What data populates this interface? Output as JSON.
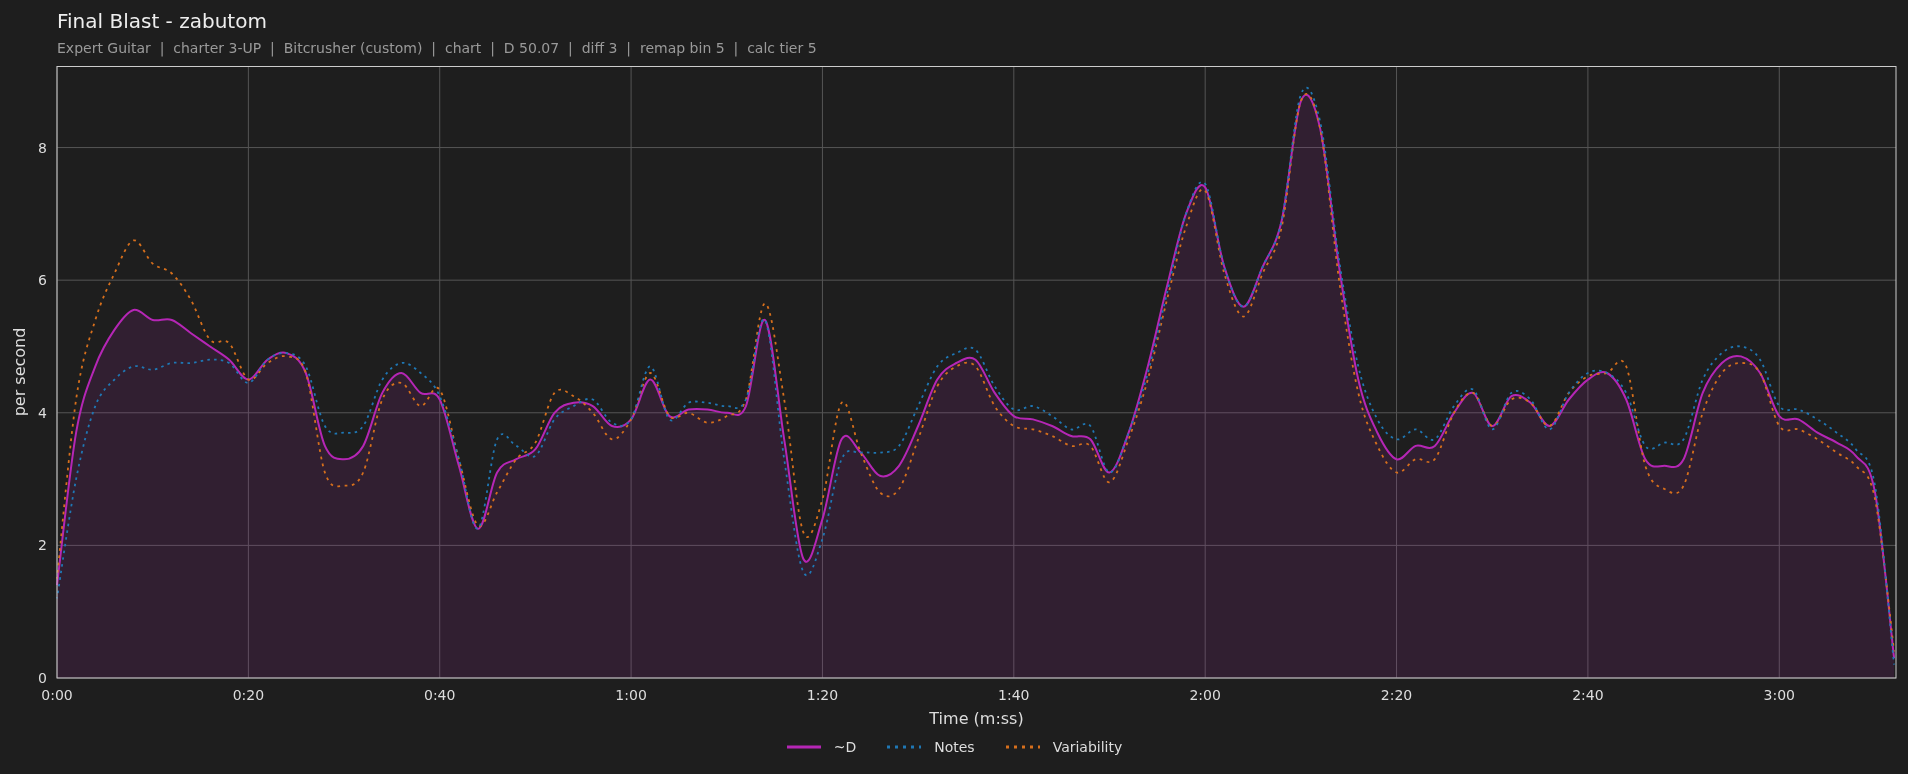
{
  "title": "Final Blast - zabutom",
  "subtitle": "Expert Guitar  |  charter 3-UP  |  Bitcrusher (custom)  |  chart  |  D 50.07  |  diff 3  |  remap bin 5  |  calc tier 5",
  "chart": {
    "chart_data": {
      "type": "line",
      "grid": true,
      "xlabel": "Time (m:ss)",
      "ylabel": "per second",
      "x": [
        0,
        2,
        4,
        6,
        8,
        10,
        12,
        14,
        16,
        18,
        20,
        22,
        24,
        26,
        28,
        30,
        32,
        34,
        36,
        38,
        40,
        42,
        44,
        46,
        48,
        50,
        52,
        54,
        56,
        58,
        60,
        62,
        64,
        66,
        68,
        70,
        72,
        74,
        76,
        78,
        80,
        82,
        84,
        86,
        88,
        90,
        92,
        94,
        96,
        98,
        100,
        102,
        104,
        106,
        108,
        110,
        112,
        114,
        116,
        118,
        120,
        122,
        124,
        126,
        128,
        130,
        132,
        134,
        136,
        138,
        140,
        142,
        144,
        146,
        148,
        150,
        152,
        154,
        156,
        158,
        160,
        162,
        164,
        166,
        168,
        170,
        172,
        174,
        176,
        178,
        180,
        182,
        184,
        186,
        188,
        190,
        192
      ],
      "series": [
        {
          "name": "~D",
          "color": "#b526b5",
          "line_style": "solid",
          "type": "area",
          "values": [
            1.4,
            3.7,
            4.7,
            5.25,
            5.55,
            5.4,
            5.4,
            5.2,
            5.0,
            4.8,
            4.5,
            4.8,
            4.9,
            4.6,
            3.5,
            3.3,
            3.5,
            4.3,
            4.6,
            4.3,
            4.2,
            3.2,
            2.25,
            3.1,
            3.3,
            3.45,
            4.0,
            4.15,
            4.1,
            3.8,
            3.9,
            4.5,
            3.95,
            4.05,
            4.05,
            4.0,
            4.1,
            5.4,
            3.6,
            1.8,
            2.4,
            3.6,
            3.4,
            3.05,
            3.2,
            3.8,
            4.5,
            4.75,
            4.8,
            4.3,
            3.95,
            3.9,
            3.8,
            3.65,
            3.6,
            3.1,
            3.7,
            4.7,
            5.9,
            7.0,
            7.4,
            6.2,
            5.6,
            6.2,
            6.9,
            8.7,
            8.3,
            6.2,
            4.5,
            3.7,
            3.3,
            3.5,
            3.5,
            4.0,
            4.3,
            3.8,
            4.25,
            4.15,
            3.8,
            4.2,
            4.5,
            4.6,
            4.2,
            3.3,
            3.2,
            3.3,
            4.3,
            4.75,
            4.85,
            4.6,
            3.95,
            3.9,
            3.7,
            3.55,
            3.35,
            2.8,
            0.3
          ]
        },
        {
          "name": "Notes",
          "color": "#1f77b4",
          "line_style": "dotted",
          "type": "line",
          "values": [
            1.2,
            3.0,
            4.1,
            4.5,
            4.7,
            4.65,
            4.75,
            4.75,
            4.8,
            4.75,
            4.45,
            4.8,
            4.9,
            4.7,
            3.8,
            3.7,
            3.8,
            4.5,
            4.75,
            4.6,
            4.25,
            3.3,
            2.25,
            3.6,
            3.5,
            3.35,
            3.9,
            4.1,
            4.2,
            3.85,
            3.9,
            4.7,
            3.9,
            4.15,
            4.15,
            4.1,
            4.2,
            5.4,
            3.3,
            1.6,
            2.1,
            3.3,
            3.4,
            3.4,
            3.5,
            4.1,
            4.7,
            4.9,
            4.95,
            4.4,
            4.05,
            4.1,
            3.95,
            3.75,
            3.8,
            3.1,
            3.7,
            4.6,
            5.8,
            7.0,
            7.45,
            6.2,
            5.6,
            6.2,
            6.9,
            8.8,
            8.4,
            6.3,
            4.7,
            3.9,
            3.6,
            3.75,
            3.6,
            4.1,
            4.35,
            3.75,
            4.3,
            4.2,
            3.75,
            4.3,
            4.6,
            4.6,
            4.3,
            3.5,
            3.55,
            3.6,
            4.5,
            4.9,
            5.0,
            4.8,
            4.1,
            4.05,
            3.9,
            3.7,
            3.45,
            2.9,
            0.2
          ]
        },
        {
          "name": "Variability",
          "color": "#d66f1c",
          "line_style": "dotted",
          "type": "line",
          "values": [
            1.5,
            4.2,
            5.4,
            6.1,
            6.6,
            6.25,
            6.1,
            5.7,
            5.1,
            5.05,
            4.5,
            4.75,
            4.85,
            4.6,
            3.1,
            2.9,
            3.1,
            4.2,
            4.45,
            4.1,
            4.35,
            3.3,
            2.3,
            2.8,
            3.3,
            3.55,
            4.3,
            4.25,
            4.0,
            3.6,
            3.9,
            4.6,
            3.95,
            4.0,
            3.85,
            3.95,
            4.2,
            5.65,
            4.2,
            2.2,
            2.7,
            4.15,
            3.4,
            2.8,
            2.85,
            3.6,
            4.4,
            4.7,
            4.7,
            4.1,
            3.8,
            3.75,
            3.65,
            3.5,
            3.5,
            2.95,
            3.6,
            4.5,
            5.7,
            6.8,
            7.35,
            6.1,
            5.45,
            6.1,
            6.8,
            8.7,
            8.3,
            6.0,
            4.3,
            3.5,
            3.1,
            3.3,
            3.3,
            4.0,
            4.3,
            3.8,
            4.2,
            4.15,
            3.8,
            4.3,
            4.55,
            4.6,
            4.7,
            3.2,
            2.85,
            2.9,
            4.0,
            4.6,
            4.75,
            4.6,
            3.8,
            3.75,
            3.6,
            3.4,
            3.2,
            2.7,
            0.4
          ]
        }
      ],
      "xlim": [
        0,
        192.2
      ],
      "ylim": [
        0,
        9.23
      ],
      "xticks": [
        {
          "value": 0,
          "label": "0:00"
        },
        {
          "value": 20,
          "label": "0:20"
        },
        {
          "value": 40,
          "label": "0:40"
        },
        {
          "value": 60,
          "label": "1:00"
        },
        {
          "value": 80,
          "label": "1:20"
        },
        {
          "value": 100,
          "label": "1:40"
        },
        {
          "value": 120,
          "label": "2:00"
        },
        {
          "value": 140,
          "label": "2:20"
        },
        {
          "value": 160,
          "label": "2:40"
        },
        {
          "value": 180,
          "label": "3:00"
        }
      ],
      "yticks": [
        0,
        2,
        4,
        6,
        8
      ]
    }
  }
}
